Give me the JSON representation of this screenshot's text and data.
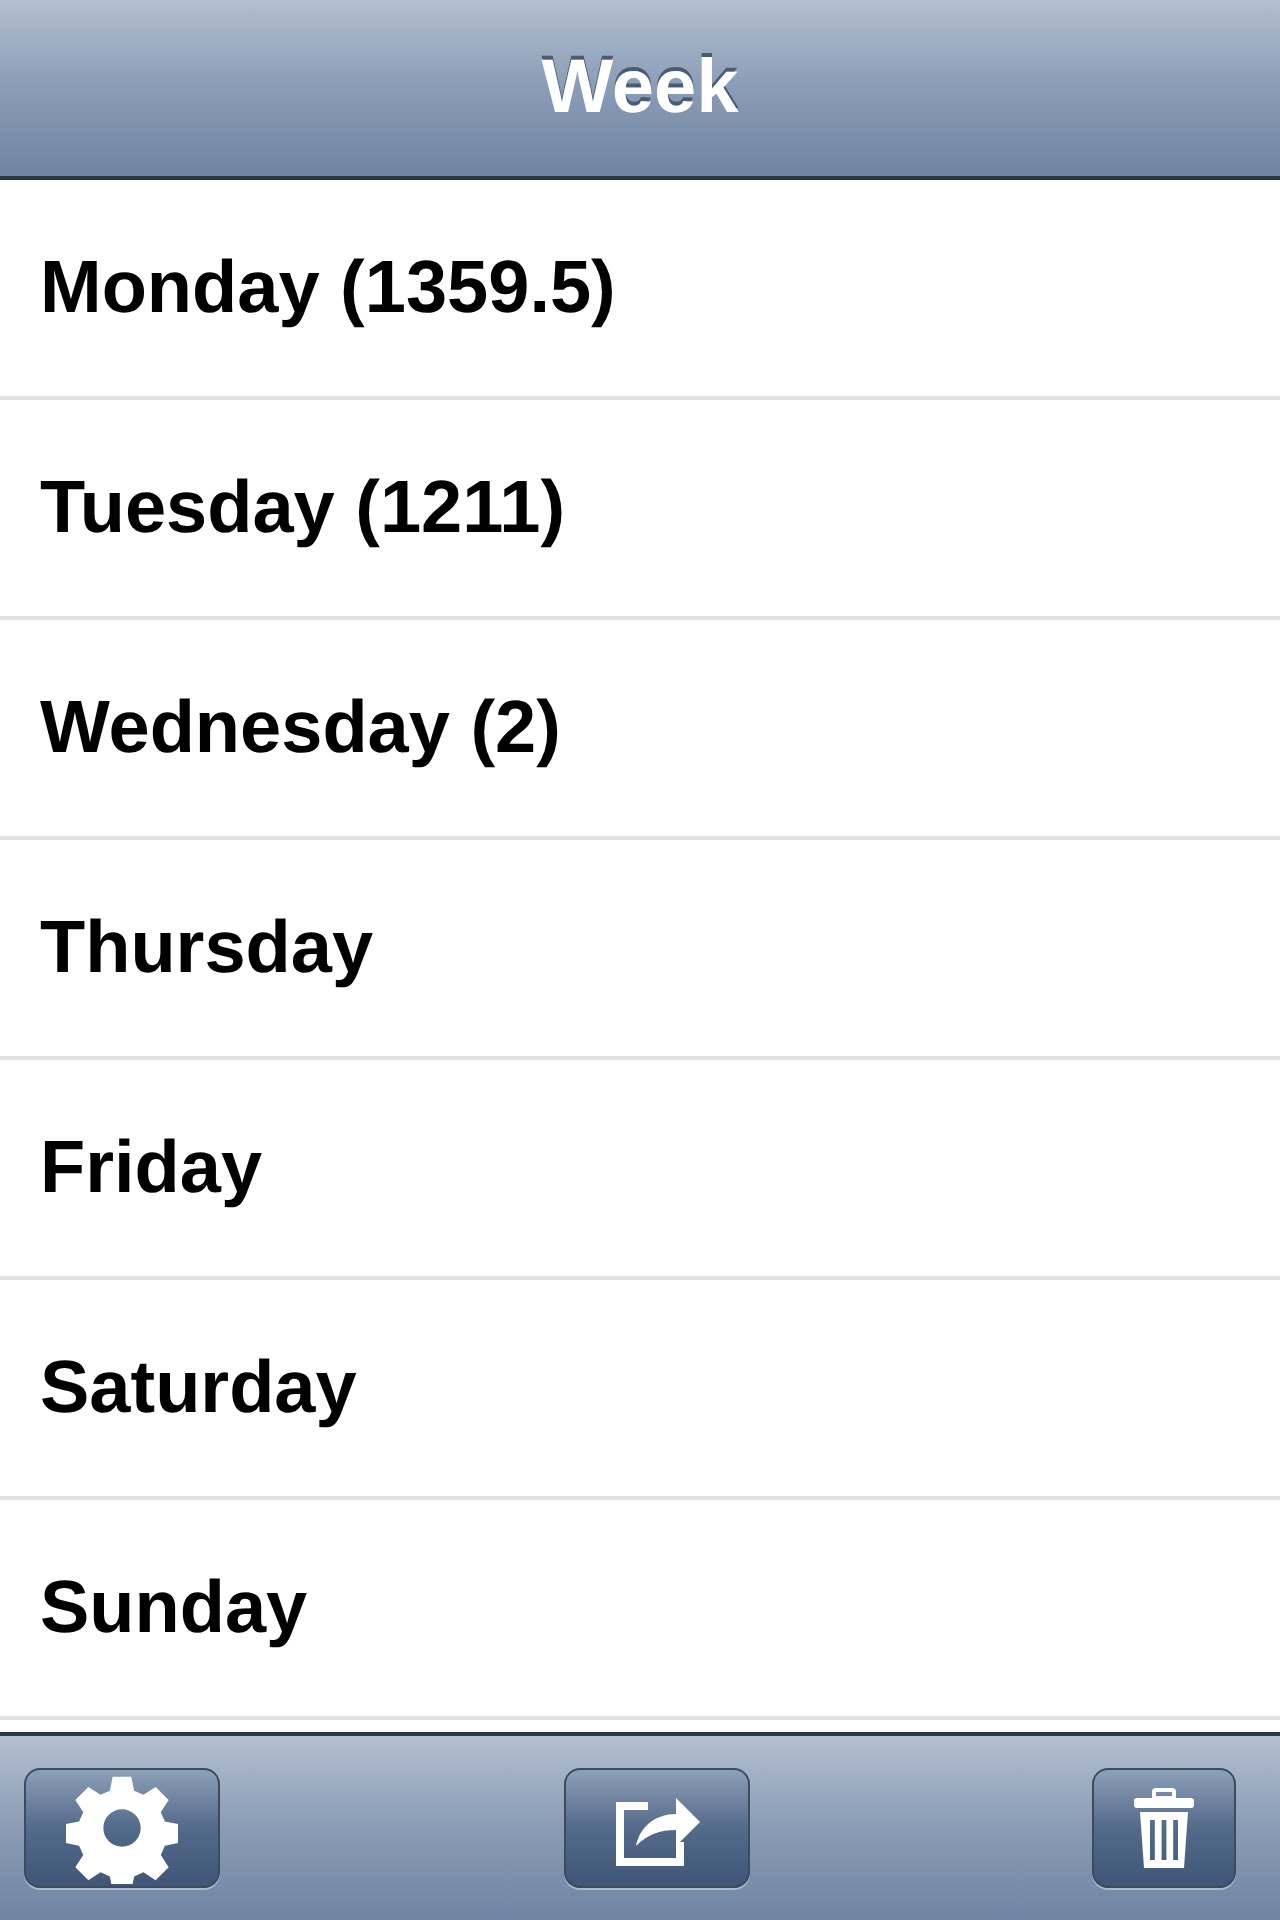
{
  "nav": {
    "title": "Week"
  },
  "days": [
    {
      "label": "Monday (1359.5)"
    },
    {
      "label": "Tuesday (1211)"
    },
    {
      "label": "Wednesday (2)"
    },
    {
      "label": "Thursday"
    },
    {
      "label": "Friday"
    },
    {
      "label": "Saturday"
    },
    {
      "label": "Sunday"
    }
  ],
  "toolbar": {
    "buttons": [
      {
        "kind": "settings"
      },
      {
        "kind": "share"
      },
      {
        "kind": "trash"
      }
    ]
  }
}
